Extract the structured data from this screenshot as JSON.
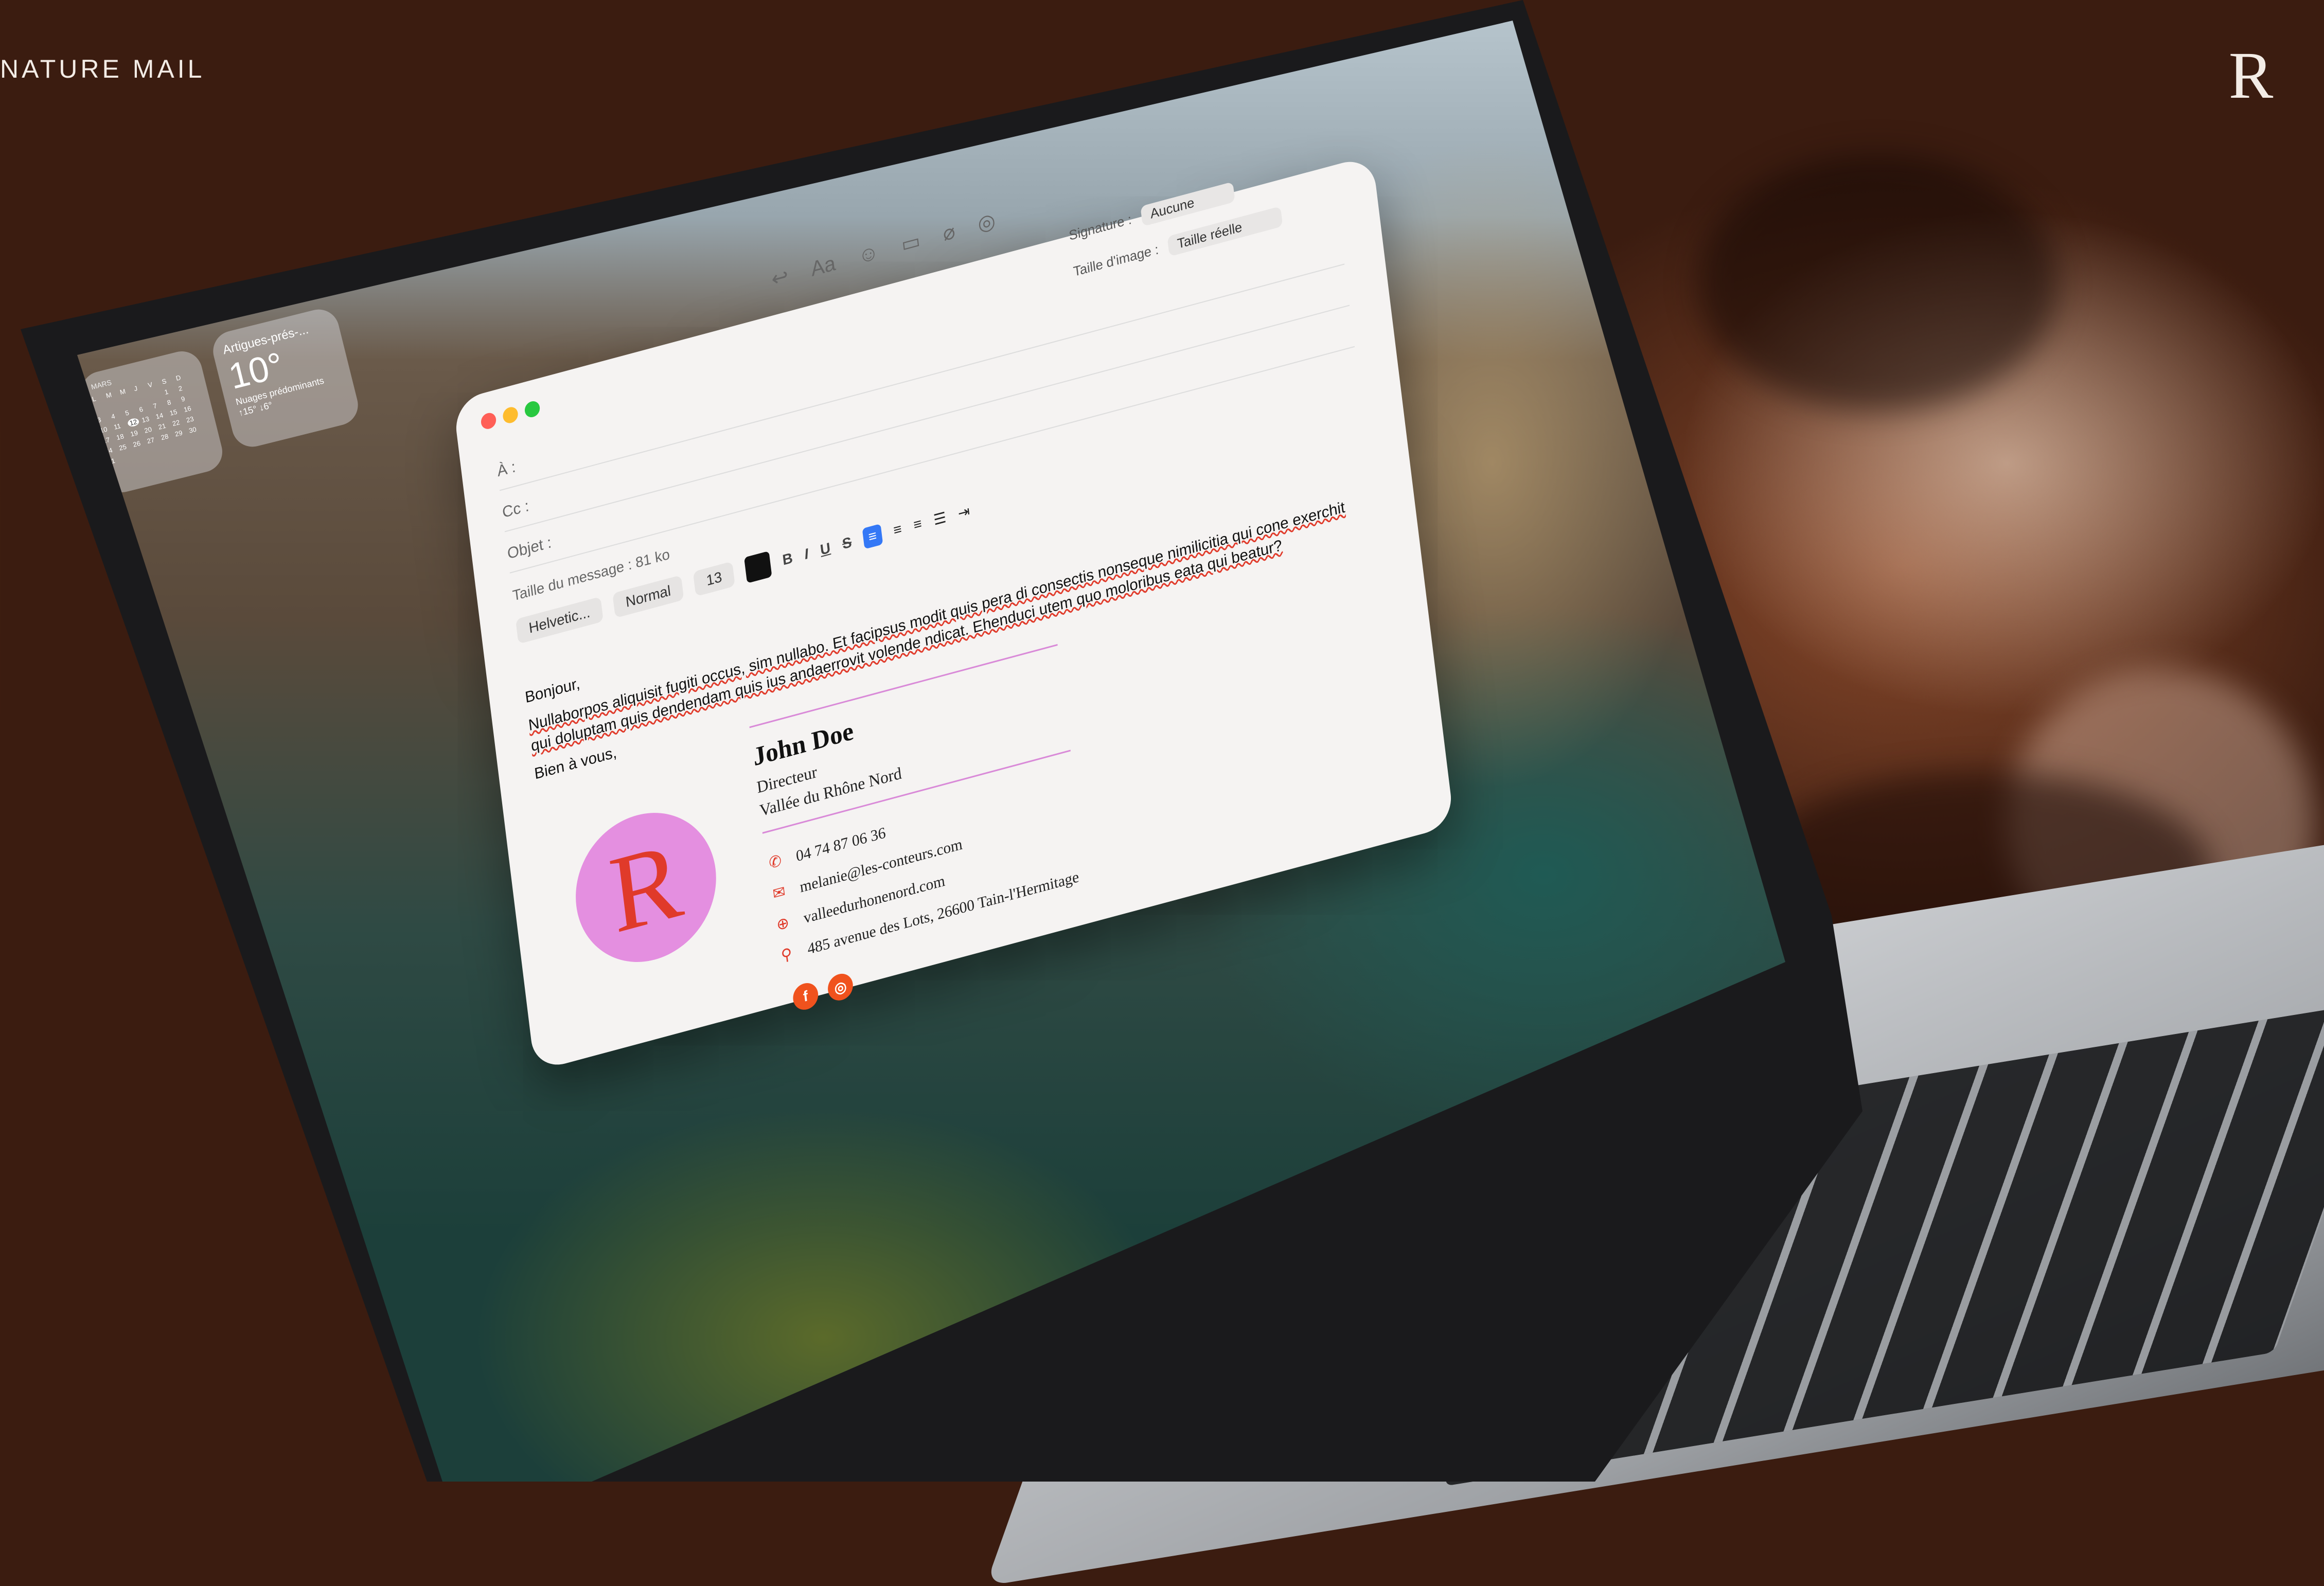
{
  "page": {
    "brand_title": "NATURE MAIL",
    "brand_logo_letter": "R",
    "colors": {
      "accent_pink": "#e48fe0",
      "accent_red": "#e03a2a",
      "accent_orange": "#f0521d",
      "highlight_blue": "#3478f6"
    }
  },
  "widgets": {
    "calendar": {
      "month": "MARS",
      "days": [
        "L",
        "M",
        "M",
        "J",
        "V",
        "S",
        "D",
        "",
        "",
        "",
        "",
        "",
        "1",
        "2",
        "3",
        "4",
        "5",
        "6",
        "7",
        "8",
        "9",
        "10",
        "11",
        "12",
        "13",
        "14",
        "15",
        "16",
        "17",
        "18",
        "19",
        "20",
        "21",
        "22",
        "23",
        "24",
        "25",
        "26",
        "27",
        "28",
        "29",
        "30",
        "31"
      ],
      "today": "12"
    },
    "weather": {
      "location": "Artigues-prés-...",
      "temperature": "10°",
      "condition": "Nuages prédominants",
      "range": "↑15° ↓6°"
    }
  },
  "mail": {
    "toolbar": {
      "reply_icon": "reply-icon",
      "font_label": "Aa",
      "emoji_icon": "smiley-icon",
      "layout_icon": "layout-icon",
      "attach_icon": "paperclip-icon",
      "more_icon": "more-icon",
      "send_icon": "send-arrow-icon"
    },
    "fields": {
      "to_label": "À :",
      "cc_label": "Cc :",
      "subject_label": "Objet :"
    },
    "signature_label": "Signature :",
    "signature_value": "Aucune",
    "image_size_label": "Taille d'image :",
    "image_size_value": "Taille réelle",
    "message_size": "Taille du message : 81 ko",
    "format_bar": {
      "font": "Helvetic...",
      "style": "Normal",
      "size": "13",
      "bold": "B",
      "italic": "I",
      "underline": "U",
      "strike": "S"
    },
    "body": {
      "greeting": "Bonjour,",
      "paragraph": "Nullaborpos aliquisit fugiti occus, sim nullabo. Et facipsus modit quis pera di consectis nonseque nimilicitia qui cone exerchit qui doluptam quis dendendam quis ius andaerrovit volende ndicat. Ehenduci utem quo moloribus eata qui beatur?",
      "closing": "Bien à vous,"
    },
    "signature": {
      "name": "John Doe",
      "role": "Directeur",
      "organization": "Vallée du Rhône Nord",
      "logo_letter": "R",
      "phone": "04 74 87 06 36",
      "email": "melanie@les-conteurs.com",
      "website": "valleedurhonenord.com",
      "address": "485 avenue des Lots, 26600 Tain-l'Hermitage",
      "social": [
        "f",
        "◎"
      ]
    }
  }
}
